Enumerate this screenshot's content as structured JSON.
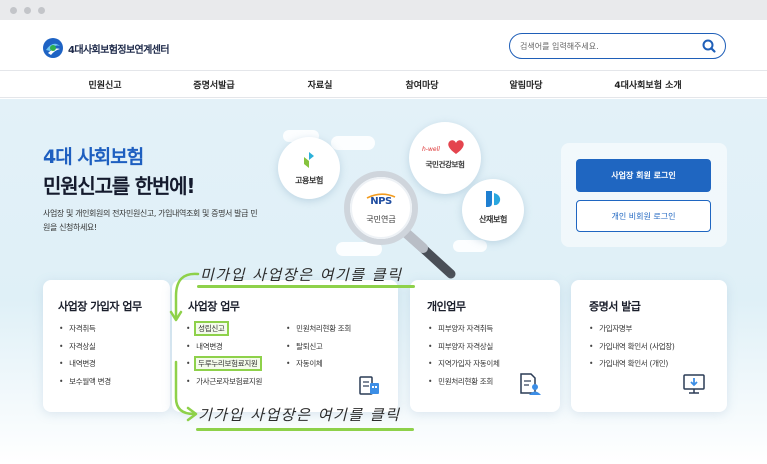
{
  "header": {
    "logo_text": "4대사회보험정보연계센터",
    "search_placeholder": "검색어를 입력해주세요."
  },
  "nav": {
    "items": [
      "민원신고",
      "증명서발급",
      "자료실",
      "참여마당",
      "알림마당",
      "4대사회보험 소개"
    ]
  },
  "hero": {
    "title_line1": "4대 사회보험",
    "title_line2": "민원신고를 한번에!",
    "desc": "사업장 및 개인회원의 전자민원신고, 가입내역조회 및 증명서 발급 민원을 신청하세요!",
    "bubbles": {
      "employment": "고용보험",
      "nps_logo": "NPS",
      "nps": "국민연금",
      "health_logo": "h-well",
      "health": "국민건강보험",
      "industrial": "산재보험"
    }
  },
  "login": {
    "business_label": "사업장 회원 로그인",
    "personal_label": "개인 비회원 로그인"
  },
  "cards": {
    "unregistered": {
      "title": "사업장 가입자 업무",
      "items": [
        "자격취득",
        "자격상실",
        "내역변경",
        "보수월액 변경"
      ]
    },
    "business": {
      "title": "사업장 업무",
      "col1": [
        "성립신고",
        "내역변경",
        "두루누리보험료지원",
        "가사근로자보험료지원"
      ],
      "col2": [
        "민원처리현황 조회",
        "탈퇴신고",
        "자동이체"
      ]
    },
    "personal": {
      "title": "개인업무",
      "items": [
        "피부양자 자격취득",
        "피부양자 자격상실",
        "지역가입자 자동이체",
        "민원처리현황 조회"
      ]
    },
    "certificate": {
      "title": "증명서 발급",
      "items": [
        "가입자명부",
        "가입내역 확인서 (사업장)",
        "가입내역 확인서 (개인)"
      ]
    }
  },
  "annotations": {
    "top": "미가입 사업장은 여기를 클릭",
    "bottom": "기가입 사업장은 여기를 클릭"
  },
  "colors": {
    "primary": "#1f66c1",
    "highlight": "#8ed14a",
    "title_blue": "#1e5fc0"
  }
}
